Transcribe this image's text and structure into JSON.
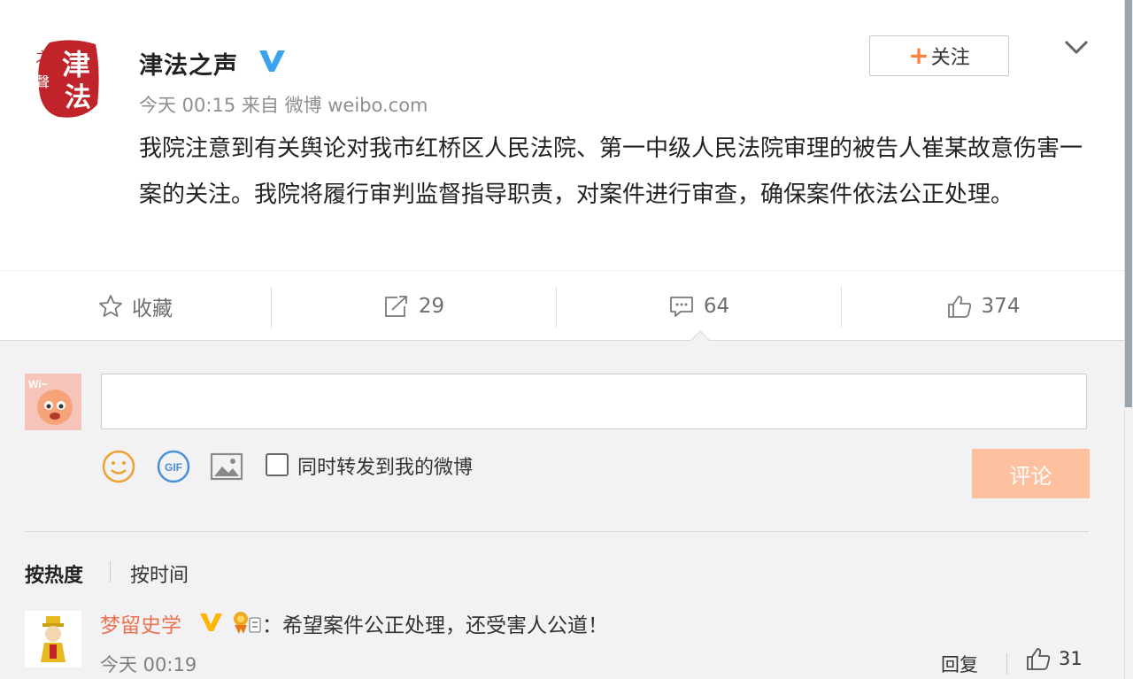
{
  "post": {
    "author": "津法之声",
    "time": "今天 00:15",
    "source_prefix": "来自",
    "source_app": "微博 weibo.com",
    "text": "我院注意到有关舆论对我市红桥区人民法院、第一中级人民法院审理的被告人崔某故意伤害一案的关注。我院将履行审判监督指导职责，对案件进行审查，确保案件依法公正处理。",
    "follow_plus": "+",
    "follow_label": "关注",
    "avatar_glyphs": {
      "main_1": "津",
      "main_2": "法",
      "side_1": "之",
      "side_2": "聲"
    }
  },
  "actions": {
    "favorite_label": "收藏",
    "repost_count": "29",
    "comment_count": "64",
    "like_count": "374"
  },
  "composer": {
    "placeholder": "",
    "avatar_text": "Wi~",
    "gif_text": "GIF",
    "repost_checkbox_label": "同时转发到我的微博",
    "submit_label": "评论"
  },
  "sort": {
    "hot_label": "按热度",
    "time_label": "按时间"
  },
  "comments": [
    {
      "name": "梦留史学",
      "text": "：希望案件公正处理，还受害人公道！",
      "time": "今天 00:19",
      "reply_label": "回复",
      "likes": "31"
    }
  ],
  "colors": {
    "brand_orange": "#ff8140",
    "username": "#eb7350",
    "verified": "#ffb400",
    "verified_blue": "#3aa3f0",
    "submit_disabled": "#ffc09f",
    "seal_red": "#c0242a"
  },
  "icons": [
    "verified-v-icon",
    "chevron-down-icon",
    "star-icon",
    "repost-icon",
    "comment-icon",
    "thumbs-up-icon",
    "emoji-icon",
    "gif-icon",
    "image-icon",
    "medal-icon"
  ]
}
